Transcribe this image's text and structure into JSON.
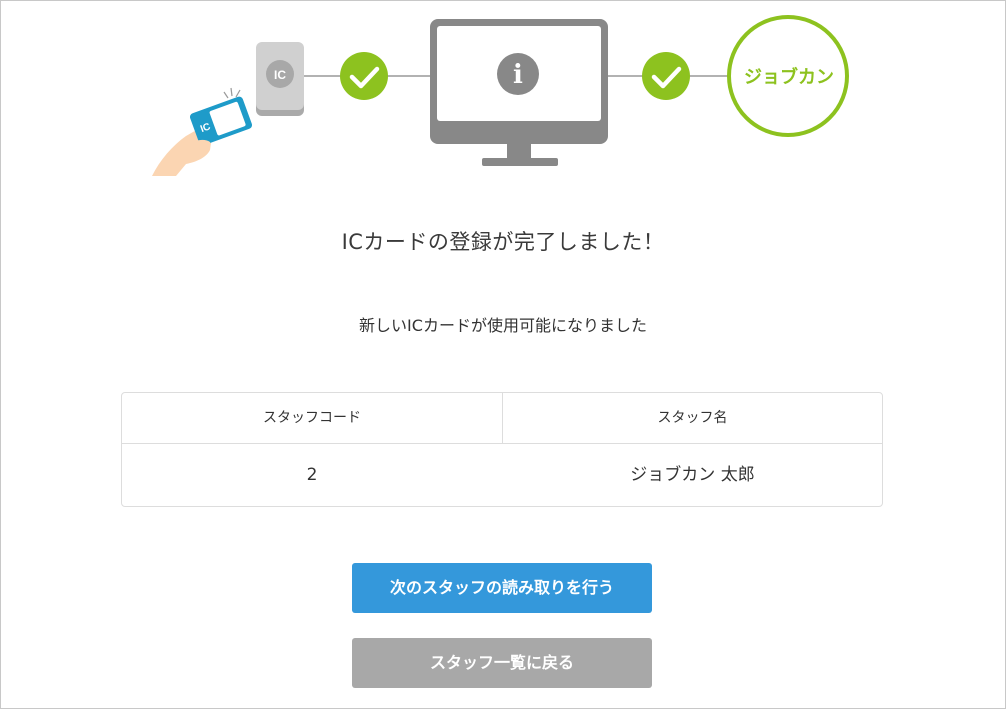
{
  "illustration": {
    "reader_label": "IC",
    "card_label": "IC",
    "info_symbol": "i",
    "brand_label": "ジョブカン",
    "colors": {
      "green": "#8dc21f",
      "gray": "#888888",
      "card_blue": "#1e9bc9"
    }
  },
  "message": {
    "title": "ICカードの登録が完了しました！",
    "subtitle": "新しいICカードが使用可能になりました"
  },
  "staff_table": {
    "headers": [
      "スタッフコード",
      "スタッフ名"
    ],
    "rows": [
      [
        "2",
        "ジョブカン 太郎"
      ]
    ]
  },
  "buttons": {
    "next_label": "次のスタッフの読み取りを行う",
    "back_label": "スタッフ一覧に戻る",
    "colors": {
      "next": "#3498db",
      "back": "#a8a8a8"
    }
  }
}
